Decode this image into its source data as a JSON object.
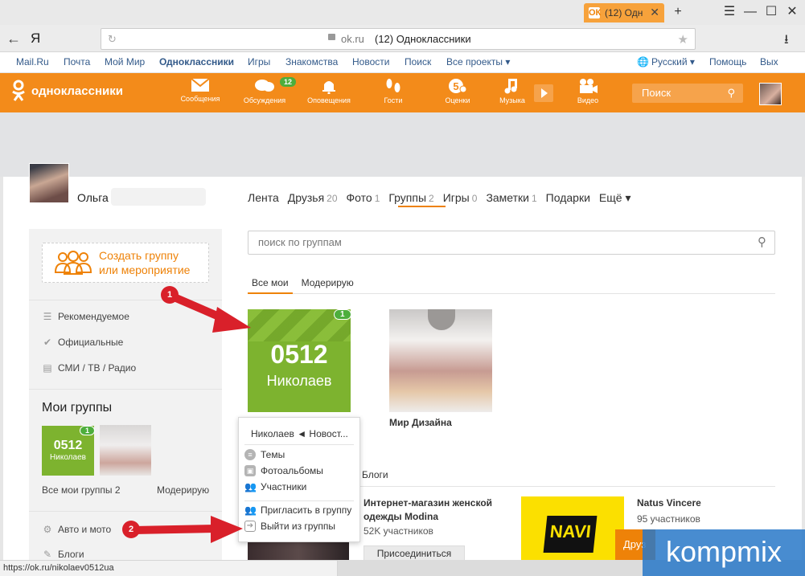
{
  "browser": {
    "tab_title": "(12) Одн",
    "tab_favicon": "ok-icon",
    "back": "←",
    "yandex": "Я",
    "url_domain": "ok.ru",
    "url_title": "(12) Одноклассники",
    "status_url": "https://ok.ru/nikolaev0512ua"
  },
  "portal_nav": [
    "Mail.Ru",
    "Почта",
    "Мой Мир",
    "Одноклассники",
    "Игры",
    "Знакомства",
    "Новости",
    "Поиск",
    "Все проекты ▾"
  ],
  "portal_right": {
    "lang": "Русский ▾",
    "help": "Помощь",
    "exit": "Вых"
  },
  "okbar": {
    "logo_text": "одноклассники",
    "tools": [
      "Сообщения",
      "Обсуждения",
      "Оповещения",
      "Гости",
      "Оценки",
      "Музыка",
      "Видео"
    ],
    "discussions_badge": "12",
    "search_placeholder": "Поиск",
    "accent_color": "#f38b1a"
  },
  "profile": {
    "name": "Ольга",
    "tabs": [
      {
        "label": "Лента",
        "count": ""
      },
      {
        "label": "Друзья",
        "count": "20"
      },
      {
        "label": "Фото",
        "count": "1"
      },
      {
        "label": "Группы",
        "count": "2"
      },
      {
        "label": "Игры",
        "count": "0"
      },
      {
        "label": "Заметки",
        "count": "1"
      },
      {
        "label": "Подарки",
        "count": ""
      },
      {
        "label": "Ещё ▾",
        "count": ""
      }
    ]
  },
  "sidebar": {
    "create_line1": "Создать группу",
    "create_line2": "или мероприятие",
    "items": [
      "Рекомендуемое",
      "Официальные",
      "СМИ / ТВ / Радио"
    ],
    "my_groups_title": "Мои группы",
    "mg1_big": "0512",
    "mg1_small": "Николаев",
    "mg1_badge": "1",
    "all_my_groups": "Все мои группы 2",
    "moderate": "Модерирую",
    "bottom_items": [
      "Авто и мото",
      "Блоги"
    ]
  },
  "groups": {
    "search_placeholder": "поиск по группам",
    "subtabs": [
      "Все мои",
      "Модерирую"
    ],
    "card1_big": "0512",
    "card1_small": "Николаев",
    "card1_badge": "1",
    "card2_name": "Мир Дизайна",
    "blogs_label": "Блоги",
    "modina_name": "Интернет-магазин женской одежды Modina",
    "modina_count": "52K участников",
    "join": "Присоединиться",
    "navi_name": "Natus Vincere",
    "navi_count": "95 участников",
    "friend_btn": "Друз"
  },
  "menu": {
    "header": "Николаев ◄ Новост...",
    "items": [
      "Темы",
      "Фотоальбомы",
      "Участники",
      "Пригласить в группу",
      "Выйти из группы"
    ]
  },
  "annotations": {
    "n1": "1",
    "n2": "2",
    "watermark": "kompmix"
  }
}
